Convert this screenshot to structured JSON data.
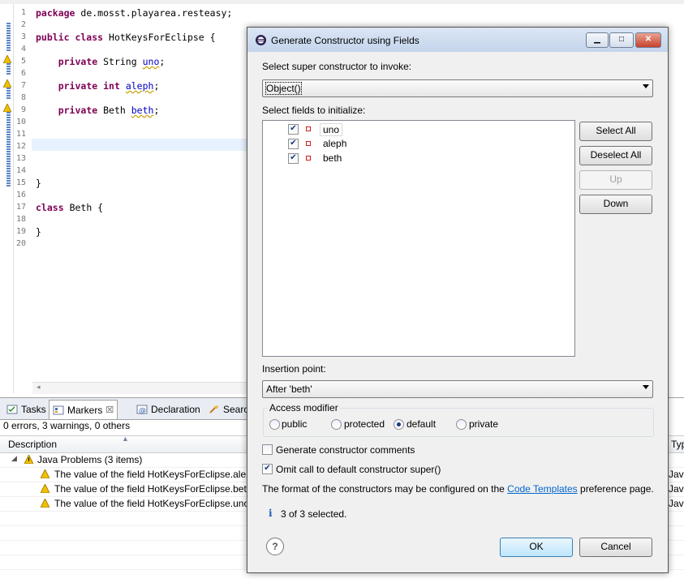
{
  "editor": {
    "package_line": "package de.mosst.playarea.resteasy;",
    "class_kw": "public class",
    "class_name": "HotKeysForEclipse {",
    "f1_kw": "private",
    "f1_type": "String",
    "f1_name": "uno",
    "f2_kw": "private",
    "f2_type": "int",
    "f2_name": "aleph",
    "f3_kw": "private",
    "f3_type": "Beth",
    "f3_name": "beth",
    "close_brace": "}",
    "class2_kw": "class",
    "class2_name": "Beth {",
    "close_brace2": "}",
    "line_numbers": [
      "1",
      "2",
      "3",
      "4",
      "5",
      "6",
      "7",
      "8",
      "9",
      "10",
      "11",
      "12",
      "13",
      "14",
      "15",
      "16",
      "17",
      "18",
      "19",
      "20"
    ]
  },
  "bottom_panel": {
    "tabs": [
      {
        "label": "Tasks",
        "icon": "tasks-icon"
      },
      {
        "label": "Markers",
        "icon": "markers-icon",
        "close": "☒"
      },
      {
        "label": "Declaration",
        "icon": "declaration-icon"
      },
      {
        "label": "Searc",
        "icon": "search-icon"
      }
    ],
    "summary": "0 errors, 3 warnings, 0 others",
    "col_description": "Description",
    "col_type": "Typ",
    "group_row": "Java Problems (3 items)",
    "rows": [
      {
        "text": "The value of the field HotKeysForEclipse.alep",
        "type": "Java"
      },
      {
        "text": "The value of the field HotKeysForEclipse.beth",
        "type": "Java"
      },
      {
        "text": "The value of the field HotKeysForEclipse.uno",
        "type": "Java"
      }
    ]
  },
  "dialog": {
    "title": "Generate Constructor using Fields",
    "super_label": "Select super constructor to invoke:",
    "super_value": "Object()",
    "fields_label": "Select fields to initialize:",
    "fields": [
      {
        "name": "uno",
        "checked": true
      },
      {
        "name": "aleph",
        "checked": true
      },
      {
        "name": "beth",
        "checked": true
      }
    ],
    "select_all": "Select All",
    "deselect_all": "Deselect All",
    "up": "Up",
    "down": "Down",
    "insertion_label": "Insertion point:",
    "insertion_value": "After 'beth'",
    "access_label": "Access modifier",
    "access_options": [
      "public",
      "protected",
      "default",
      "private"
    ],
    "access_selected": "default",
    "gen_comments": "Generate constructor comments",
    "gen_comments_checked": false,
    "omit_super": "Omit call to default constructor super()",
    "omit_super_checked": true,
    "format_text": "The format of the constructors may be configured on the",
    "code_templates_link": "Code Templates",
    "format_suffix": "preference page.",
    "status": "3 of 3 selected.",
    "ok": "OK",
    "cancel": "Cancel",
    "help": "?"
  }
}
